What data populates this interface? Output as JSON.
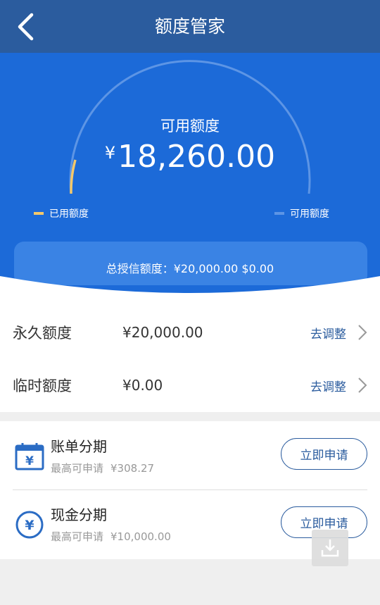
{
  "header": {
    "title": "额度管家"
  },
  "hero": {
    "available_label": "可用额度",
    "currency": "¥",
    "available_amount": "18,260.00",
    "used_fraction": 0.087,
    "legend": {
      "used": "已用额度",
      "available": "可用额度"
    },
    "total_credit_text": "总授信额度：¥20,000.00  $0.00",
    "colors": {
      "used": "#f3c86b",
      "available": "#5d95e5"
    }
  },
  "quotas": [
    {
      "label": "永久额度",
      "value": "¥20,000.00",
      "action": "去调整"
    },
    {
      "label": "临时额度",
      "value": "¥0.00",
      "action": "去调整"
    }
  ],
  "installments": [
    {
      "name": "账单分期",
      "max_label": "最高可申请",
      "max_value": "¥308.27",
      "button": "立即申请",
      "icon": "calendar-yen-icon"
    },
    {
      "name": "现金分期",
      "max_label": "最高可申请",
      "max_value": "¥10,000.00",
      "button": "立即申请",
      "icon": "yen-circle-icon"
    }
  ]
}
